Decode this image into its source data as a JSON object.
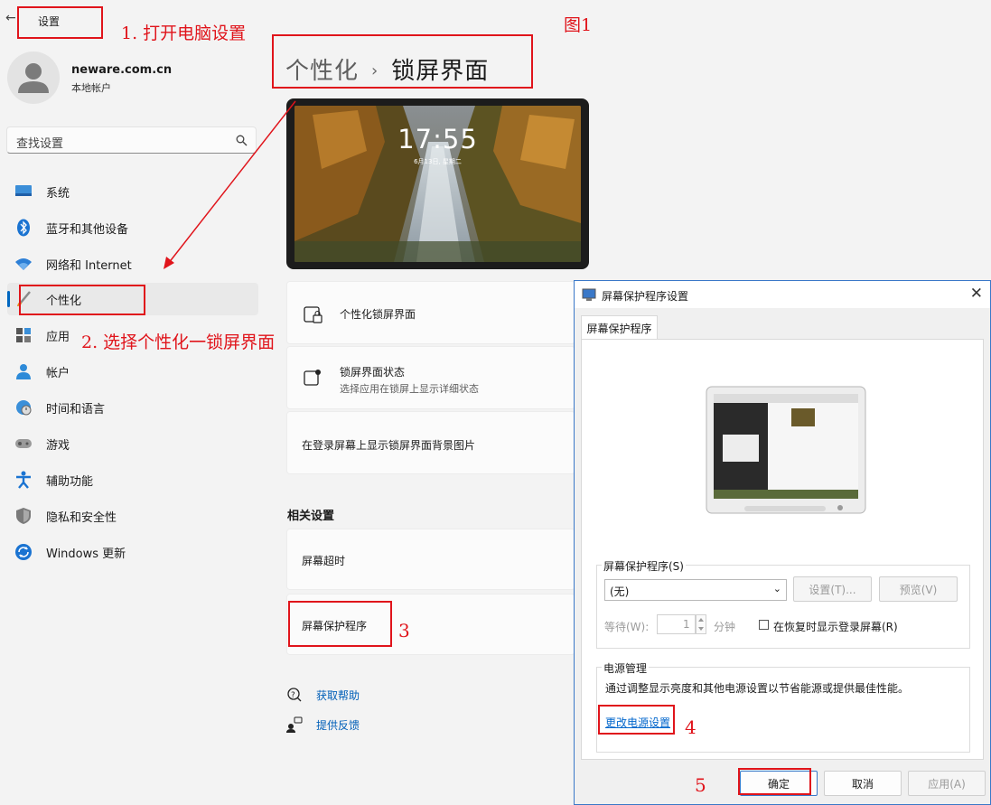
{
  "annotations": {
    "step1": "1. 打开电脑设置",
    "step2": "2. 选择个性化一锁屏界面",
    "step3": "3",
    "step4": "4",
    "step5": "5",
    "figure": "图1",
    "color": "#e0141b"
  },
  "app": {
    "title": "设置",
    "back_icon": "back-arrow-icon"
  },
  "account": {
    "name": "neware.com.cn",
    "type": "本地帐户"
  },
  "search": {
    "placeholder": "查找设置",
    "icon": "search-icon"
  },
  "nav": {
    "items": [
      {
        "label": "系统",
        "icon": "monitor-icon"
      },
      {
        "label": "蓝牙和其他设备",
        "icon": "bluetooth-icon"
      },
      {
        "label": "网络和 Internet",
        "icon": "wifi-icon"
      },
      {
        "label": "个性化",
        "icon": "brush-icon",
        "selected": true
      },
      {
        "label": "应用",
        "icon": "apps-icon"
      },
      {
        "label": "帐户",
        "icon": "person-icon"
      },
      {
        "label": "时间和语言",
        "icon": "globe-clock-icon"
      },
      {
        "label": "游戏",
        "icon": "gamepad-icon"
      },
      {
        "label": "辅助功能",
        "icon": "accessibility-icon"
      },
      {
        "label": "隐私和安全性",
        "icon": "shield-icon"
      },
      {
        "label": "Windows 更新",
        "icon": "refresh-icon"
      }
    ],
    "accent": "#0067c0"
  },
  "main": {
    "breadcrumb_parent": "个性化",
    "breadcrumb_current": "锁屏界面",
    "lock_preview": {
      "time": "17:55",
      "date": "6月13日, 星期二"
    },
    "cards": {
      "personalize": "个性化锁屏界面",
      "status_title": "锁屏界面状态",
      "status_sub": "选择应用在锁屏上显示详细状态",
      "show_bg": "在登录屏幕上显示锁屏界面背景图片"
    },
    "related_label": "相关设置",
    "related": {
      "timeout": "屏幕超时",
      "screensaver": "屏幕保护程序"
    },
    "help": {
      "get_help": "获取帮助",
      "feedback": "提供反馈"
    }
  },
  "dialog": {
    "title": "屏幕保护程序设置",
    "tab": "屏幕保护程序",
    "saver_group": "屏幕保护程序(S)",
    "saver_value": "(无)",
    "settings_btn": "设置(T)...",
    "preview_btn": "预览(V)",
    "wait_label": "等待(W):",
    "wait_value": "1",
    "minutes": "分钟",
    "resume_label": "在恢复时显示登录屏幕(R)",
    "resume_checked": false,
    "power_group": "电源管理",
    "power_desc": "通过调整显示亮度和其他电源设置以节省能源或提供最佳性能。",
    "power_link": "更改电源设置",
    "ok": "确定",
    "cancel": "取消",
    "apply": "应用(A)"
  }
}
